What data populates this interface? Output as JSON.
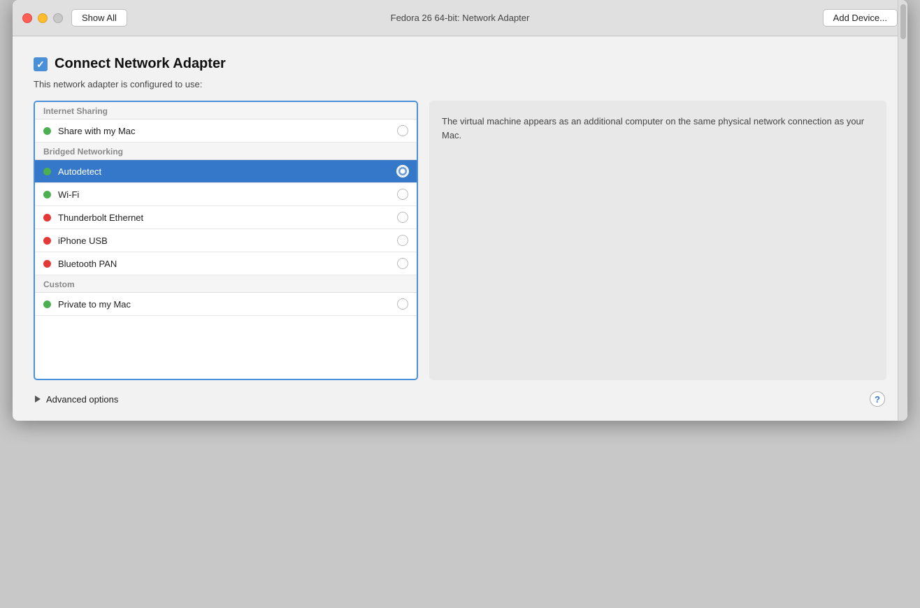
{
  "titlebar": {
    "show_all_label": "Show All",
    "window_title": "Fedora 26 64-bit: Network Adapter",
    "add_device_label": "Add Device..."
  },
  "header": {
    "main_title": "Connect Network Adapter",
    "subtitle": "This network adapter is configured to use:"
  },
  "sections": [
    {
      "id": "internet-sharing",
      "header": "Internet Sharing",
      "items": [
        {
          "id": "share-mac",
          "label": "Share with my Mac",
          "dot_color": "green",
          "selected": false
        }
      ]
    },
    {
      "id": "bridged-networking",
      "header": "Bridged Networking",
      "items": [
        {
          "id": "autodetect",
          "label": "Autodetect",
          "dot_color": "green",
          "selected": true
        },
        {
          "id": "wifi",
          "label": "Wi-Fi",
          "dot_color": "green",
          "selected": false
        },
        {
          "id": "thunderbolt",
          "label": "Thunderbolt Ethernet",
          "dot_color": "red",
          "selected": false
        },
        {
          "id": "iphone-usb",
          "label": "iPhone USB",
          "dot_color": "red",
          "selected": false
        },
        {
          "id": "bluetooth",
          "label": "Bluetooth PAN",
          "dot_color": "red",
          "selected": false
        }
      ]
    },
    {
      "id": "custom",
      "header": "Custom",
      "items": [
        {
          "id": "private-mac",
          "label": "Private to my Mac",
          "dot_color": "green",
          "selected": false
        }
      ]
    }
  ],
  "description_text": "The virtual machine appears as an additional computer on the same physical network connection as your Mac.",
  "advanced_options_label": "Advanced options",
  "help_label": "?"
}
